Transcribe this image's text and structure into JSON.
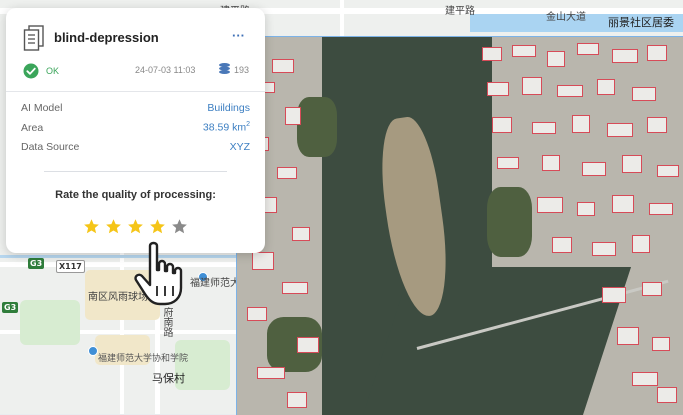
{
  "map": {
    "labels": {
      "top_left": "建平路",
      "top_mid": "建平路",
      "top_right_1": "金山大道",
      "top_right_2": "丽景社区居委",
      "highway_g3": "G3",
      "highway_x117": "X117",
      "highway_g3b": "G3",
      "normal_univ": "福建师范大学",
      "stadium": "南区风雨球场",
      "road_south": "府南路",
      "college": "福建师范大学协和学院",
      "village": "马保村"
    }
  },
  "card": {
    "title": "blind-depression",
    "menu_label": "···",
    "status": "OK",
    "date": "24-07-03 11:03",
    "count": "193",
    "rows": [
      {
        "label": "AI Model",
        "value": "Buildings"
      },
      {
        "label": "Area",
        "value": "38.59 km",
        "unit_sup": "2"
      },
      {
        "label": "Data Source",
        "value": "XYZ"
      }
    ],
    "rate_label": "Rate the quality of processing:",
    "rating": 4,
    "rating_max": 5
  },
  "colors": {
    "accent": "#3d7fc2",
    "ok": "#3aa55a",
    "star_on": "#f5c518",
    "star_off": "#8a8a8a",
    "building_outline": "#d74b58"
  },
  "icons": [
    "document-icon",
    "check-circle-icon",
    "coins-icon",
    "star-icon",
    "hand-cursor-icon"
  ]
}
